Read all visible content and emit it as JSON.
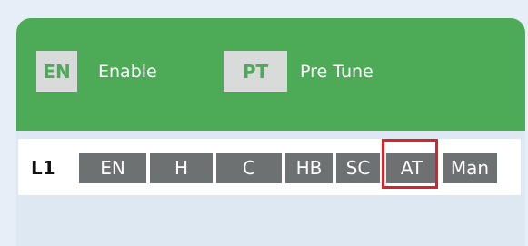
{
  "header": {
    "enable_button": "EN",
    "enable_label": "Enable",
    "pretune_button": "PT",
    "pretune_label": "Pre Tune"
  },
  "row": {
    "label": "L1",
    "tags": [
      "EN",
      "H",
      "C",
      "HB",
      "SC",
      "AT",
      "Man"
    ],
    "selected_tag": "AT"
  },
  "colors": {
    "header_green": "#4daa57",
    "tag_gray": "#6e7172",
    "selection_red": "#d9232a",
    "panel_bg": "#dde8f3"
  }
}
